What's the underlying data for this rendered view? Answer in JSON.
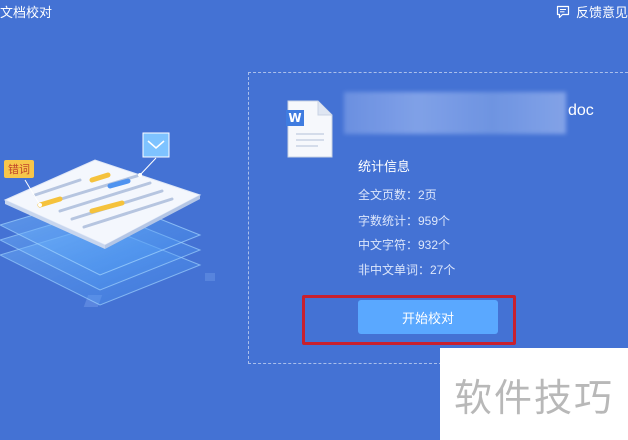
{
  "header": {
    "title": "文档校对",
    "feedback_label": "反馈意见"
  },
  "illustration": {
    "tag_label": "错词"
  },
  "file": {
    "extension": "doc"
  },
  "stats": {
    "heading": "统计信息",
    "rows": [
      "全文页数：2页",
      "字数统计：959个",
      "中文字符：932个",
      "非中文单词：27个"
    ]
  },
  "actions": {
    "start_label": "开始校对"
  },
  "watermark": {
    "text": "软件技巧"
  },
  "colors": {
    "background": "#4472d4",
    "button": "#5aa8ff",
    "highlight": "#c8202e",
    "watermark_text": "#b8b8b8"
  }
}
